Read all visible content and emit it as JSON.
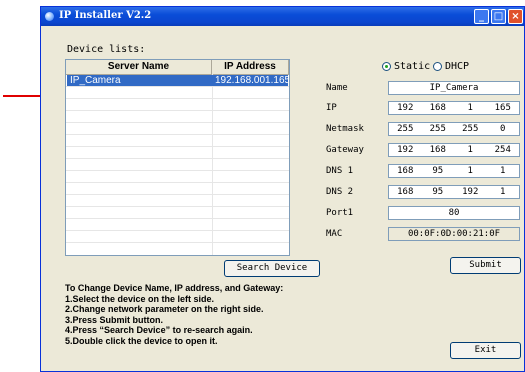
{
  "window": {
    "title": "IP Installer V2.2"
  },
  "devices": {
    "group_label": "Device lists:",
    "columns": [
      "Server Name",
      "IP Address"
    ],
    "rows": [
      {
        "name": "IP_Camera",
        "ip": "192.168.001.165",
        "selected": true
      }
    ]
  },
  "buttons": {
    "search": "Search Device",
    "submit": "Submit",
    "exit": "Exit"
  },
  "mode": {
    "static_label": "Static",
    "dhcp_label": "DHCP",
    "selected": "Static"
  },
  "form": {
    "name_label": "Name",
    "name_value": "IP_Camera",
    "ip_label": "IP",
    "ip_octets": [
      "192",
      "168",
      "1",
      "165"
    ],
    "netmask_label": "Netmask",
    "netmask_octets": [
      "255",
      "255",
      "255",
      "0"
    ],
    "gateway_label": "Gateway",
    "gateway_octets": [
      "192",
      "168",
      "1",
      "254"
    ],
    "dns1_label": "DNS 1",
    "dns1_octets": [
      "168",
      "95",
      "1",
      "1"
    ],
    "dns2_label": "DNS 2",
    "dns2_octets": [
      "168",
      "95",
      "192",
      "1"
    ],
    "port_label": "Port1",
    "port_value": "80",
    "mac_label": "MAC",
    "mac_value": "00:0F:0D:00:21:0F"
  },
  "instructions": {
    "heading": "To Change Device Name, IP address, and Gateway:",
    "steps": [
      "1.Select the device on the left side.",
      "2.Change network parameter on the right side.",
      "3.Press Submit button.",
      "4.Press “Search Device” to re-search again.",
      "5.Double click the device to open it."
    ]
  },
  "colors": {
    "arrow": "#e00000",
    "selection": "#316ac5",
    "titlebar": "#0a4dd8"
  }
}
